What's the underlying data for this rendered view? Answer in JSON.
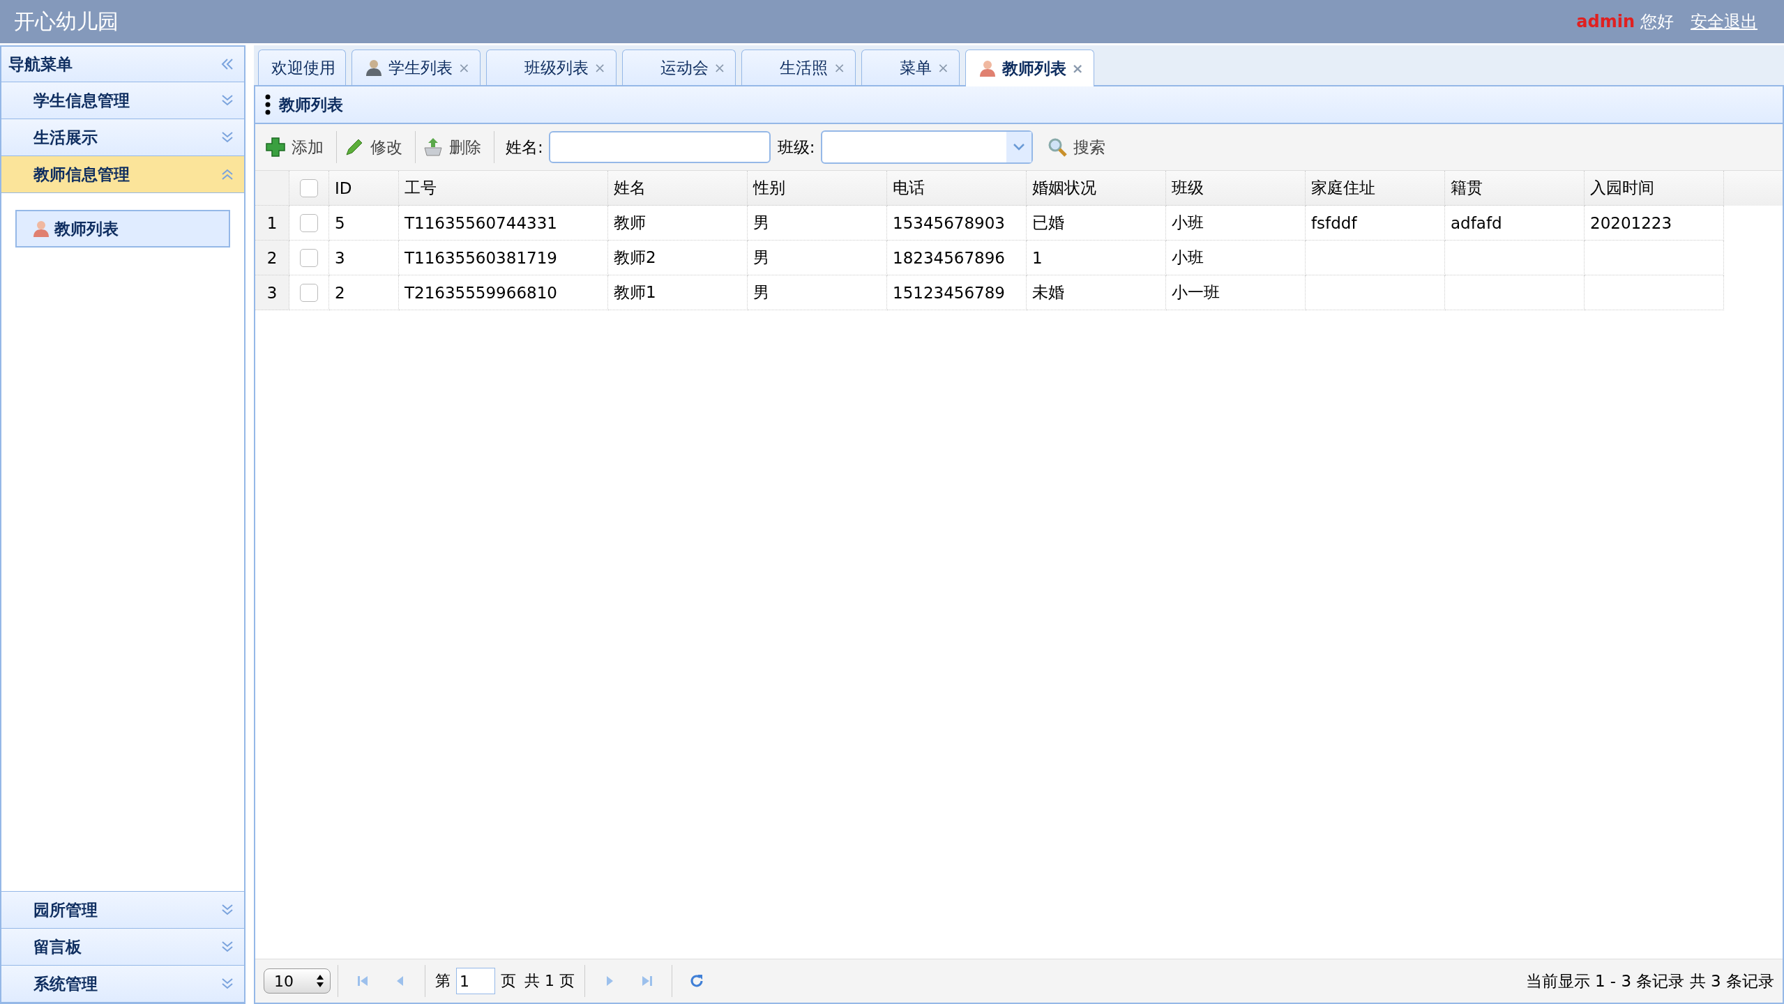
{
  "header": {
    "title": "开心幼儿园",
    "user": "admin",
    "greeting": "您好",
    "logout": "安全退出"
  },
  "sidebar": {
    "title": "导航菜单",
    "sections": [
      {
        "label": "学生信息管理",
        "expanded": false
      },
      {
        "label": "生活展示",
        "expanded": false
      },
      {
        "label": "教师信息管理",
        "expanded": true,
        "items": [
          {
            "label": "教师列表",
            "selected": true
          }
        ]
      },
      {
        "label": "园所管理",
        "expanded": false
      },
      {
        "label": "留言板",
        "expanded": false
      },
      {
        "label": "系统管理",
        "expanded": false
      }
    ]
  },
  "tabs": [
    {
      "label": "欢迎使用",
      "kind": "plain",
      "selected": false
    },
    {
      "label": "学生列表",
      "kind": "student",
      "close": "×",
      "selected": false
    },
    {
      "label": "班级列表",
      "kind": "plain",
      "close": "×",
      "selected": false
    },
    {
      "label": "运动会",
      "kind": "plain",
      "close": "×",
      "selected": false
    },
    {
      "label": "生活照",
      "kind": "plain",
      "close": "×",
      "selected": false
    },
    {
      "label": "菜单",
      "kind": "plain",
      "close": "×",
      "selected": false
    },
    {
      "label": "教师列表",
      "kind": "teacher",
      "close": "×",
      "selected": true
    }
  ],
  "panel": {
    "title": "教师列表"
  },
  "toolbar": {
    "buttons": [
      {
        "label": "添加",
        "kind": "add"
      },
      {
        "label": "修改",
        "kind": "edit"
      },
      {
        "label": "删除",
        "kind": "delete"
      }
    ],
    "name_label": "姓名:",
    "class_label": "班级:",
    "search": "搜索"
  },
  "table": {
    "columns": [
      "ID",
      "工号",
      "姓名",
      "性别",
      "电话",
      "婚姻状况",
      "班级",
      "家庭住址",
      "籍贯",
      "入园时间"
    ],
    "header_checked": false,
    "rows": [
      {
        "number": "1",
        "checked": false,
        "cells": [
          "5",
          "T11635560744331",
          "教师",
          "男",
          "15345678903",
          "已婚",
          "小班",
          "fsfddf",
          "adfafd",
          "20201223"
        ]
      },
      {
        "number": "2",
        "checked": false,
        "cells": [
          "3",
          "T11635560381719",
          "教师2",
          "男",
          "18234567896",
          "1",
          "小班",
          "",
          "",
          ""
        ]
      },
      {
        "number": "3",
        "checked": false,
        "cells": [
          "2",
          "T21635559966810",
          "教师1",
          "男",
          "15123456789",
          "未婚",
          "小一班",
          "",
          "",
          ""
        ]
      }
    ]
  },
  "pager": {
    "page_size": "10",
    "page_prefix": "第",
    "page": "1",
    "page_word": "页",
    "total_pages": "共 1 页",
    "summary": "当前显示 1 - 3 条记录 共 3 条记录"
  }
}
